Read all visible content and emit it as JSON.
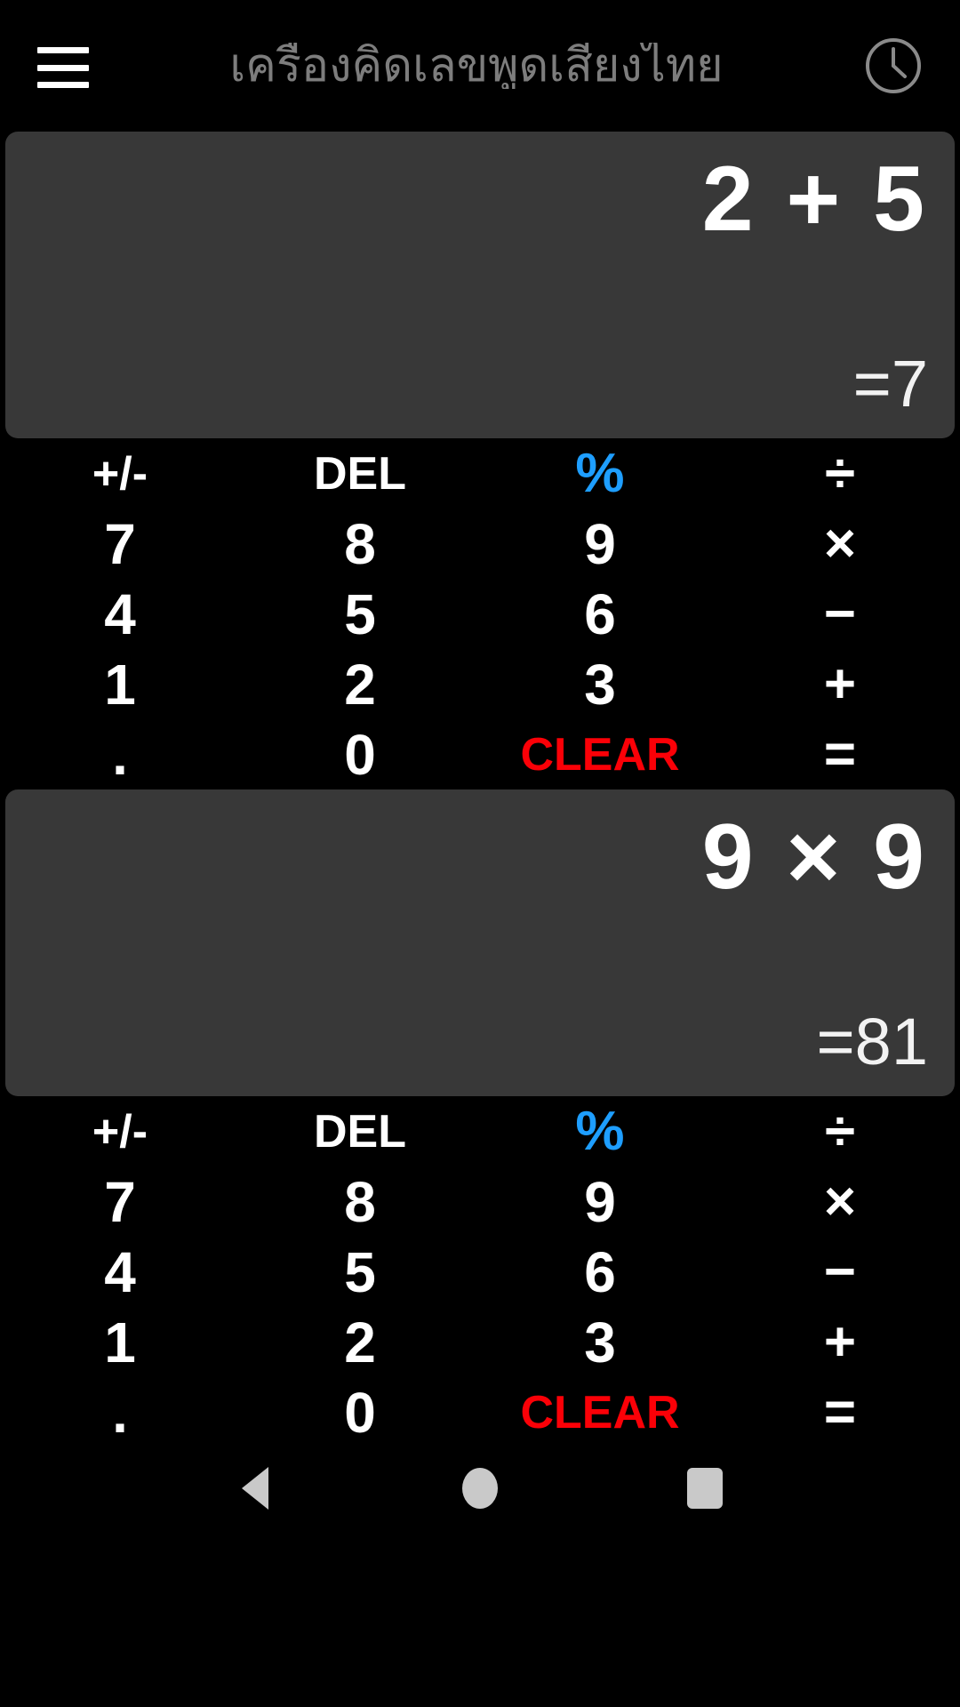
{
  "header": {
    "menu_icon": "hamburger-menu-icon",
    "title": "เครื่องคิดเลขพูดเสียงไทย",
    "history_icon": "clock-icon"
  },
  "panels": [
    {
      "display": {
        "expression": "2 + 5",
        "result": "=7"
      },
      "keypad": {
        "rows": [
          [
            {
              "label": "+/-",
              "style": "small",
              "name": "key-sign-toggle"
            },
            {
              "label": "DEL",
              "style": "small",
              "name": "key-delete"
            },
            {
              "label": "%",
              "style": "accent",
              "name": "key-percent"
            },
            {
              "label": "÷",
              "style": "op",
              "name": "key-divide"
            }
          ],
          [
            {
              "label": "7",
              "style": "num",
              "name": "key-7"
            },
            {
              "label": "8",
              "style": "num",
              "name": "key-8"
            },
            {
              "label": "9",
              "style": "num",
              "name": "key-9"
            },
            {
              "label": "×",
              "style": "op",
              "name": "key-multiply"
            }
          ],
          [
            {
              "label": "4",
              "style": "num",
              "name": "key-4"
            },
            {
              "label": "5",
              "style": "num",
              "name": "key-5"
            },
            {
              "label": "6",
              "style": "num",
              "name": "key-6"
            },
            {
              "label": "−",
              "style": "op",
              "name": "key-minus"
            }
          ],
          [
            {
              "label": "1",
              "style": "num",
              "name": "key-1"
            },
            {
              "label": "2",
              "style": "num",
              "name": "key-2"
            },
            {
              "label": "3",
              "style": "num",
              "name": "key-3"
            },
            {
              "label": "+",
              "style": "op",
              "name": "key-plus"
            }
          ],
          [
            {
              "label": ".",
              "style": "dot",
              "name": "key-decimal"
            },
            {
              "label": "0",
              "style": "num",
              "name": "key-0"
            },
            {
              "label": "CLEAR",
              "style": "danger",
              "name": "key-clear"
            },
            {
              "label": "=",
              "style": "op",
              "name": "key-equals"
            }
          ]
        ]
      }
    },
    {
      "display": {
        "expression": "9 × 9",
        "result": "=81"
      },
      "keypad": {
        "rows": [
          [
            {
              "label": "+/-",
              "style": "small",
              "name": "key-sign-toggle"
            },
            {
              "label": "DEL",
              "style": "small",
              "name": "key-delete"
            },
            {
              "label": "%",
              "style": "accent",
              "name": "key-percent"
            },
            {
              "label": "÷",
              "style": "op",
              "name": "key-divide"
            }
          ],
          [
            {
              "label": "7",
              "style": "num",
              "name": "key-7"
            },
            {
              "label": "8",
              "style": "num",
              "name": "key-8"
            },
            {
              "label": "9",
              "style": "num",
              "name": "key-9"
            },
            {
              "label": "×",
              "style": "op",
              "name": "key-multiply"
            }
          ],
          [
            {
              "label": "4",
              "style": "num",
              "name": "key-4"
            },
            {
              "label": "5",
              "style": "num",
              "name": "key-5"
            },
            {
              "label": "6",
              "style": "num",
              "name": "key-6"
            },
            {
              "label": "−",
              "style": "op",
              "name": "key-minus"
            }
          ],
          [
            {
              "label": "1",
              "style": "num",
              "name": "key-1"
            },
            {
              "label": "2",
              "style": "num",
              "name": "key-2"
            },
            {
              "label": "3",
              "style": "num",
              "name": "key-3"
            },
            {
              "label": "+",
              "style": "op",
              "name": "key-plus"
            }
          ],
          [
            {
              "label": ".",
              "style": "dot",
              "name": "key-decimal"
            },
            {
              "label": "0",
              "style": "num",
              "name": "key-0"
            },
            {
              "label": "CLEAR",
              "style": "danger",
              "name": "key-clear"
            },
            {
              "label": "=",
              "style": "op",
              "name": "key-equals"
            }
          ]
        ]
      }
    }
  ],
  "navbar": {
    "back": "back-triangle-icon",
    "home": "home-circle-icon",
    "recents": "recents-square-icon"
  },
  "colors": {
    "background": "#000000",
    "display_panel": "#383838",
    "text_primary": "#ffffff",
    "title_muted": "#7d7d7d",
    "accent_blue": "#1e9eff",
    "danger_red": "#fb0007",
    "nav_icon": "#c9c9c9"
  }
}
